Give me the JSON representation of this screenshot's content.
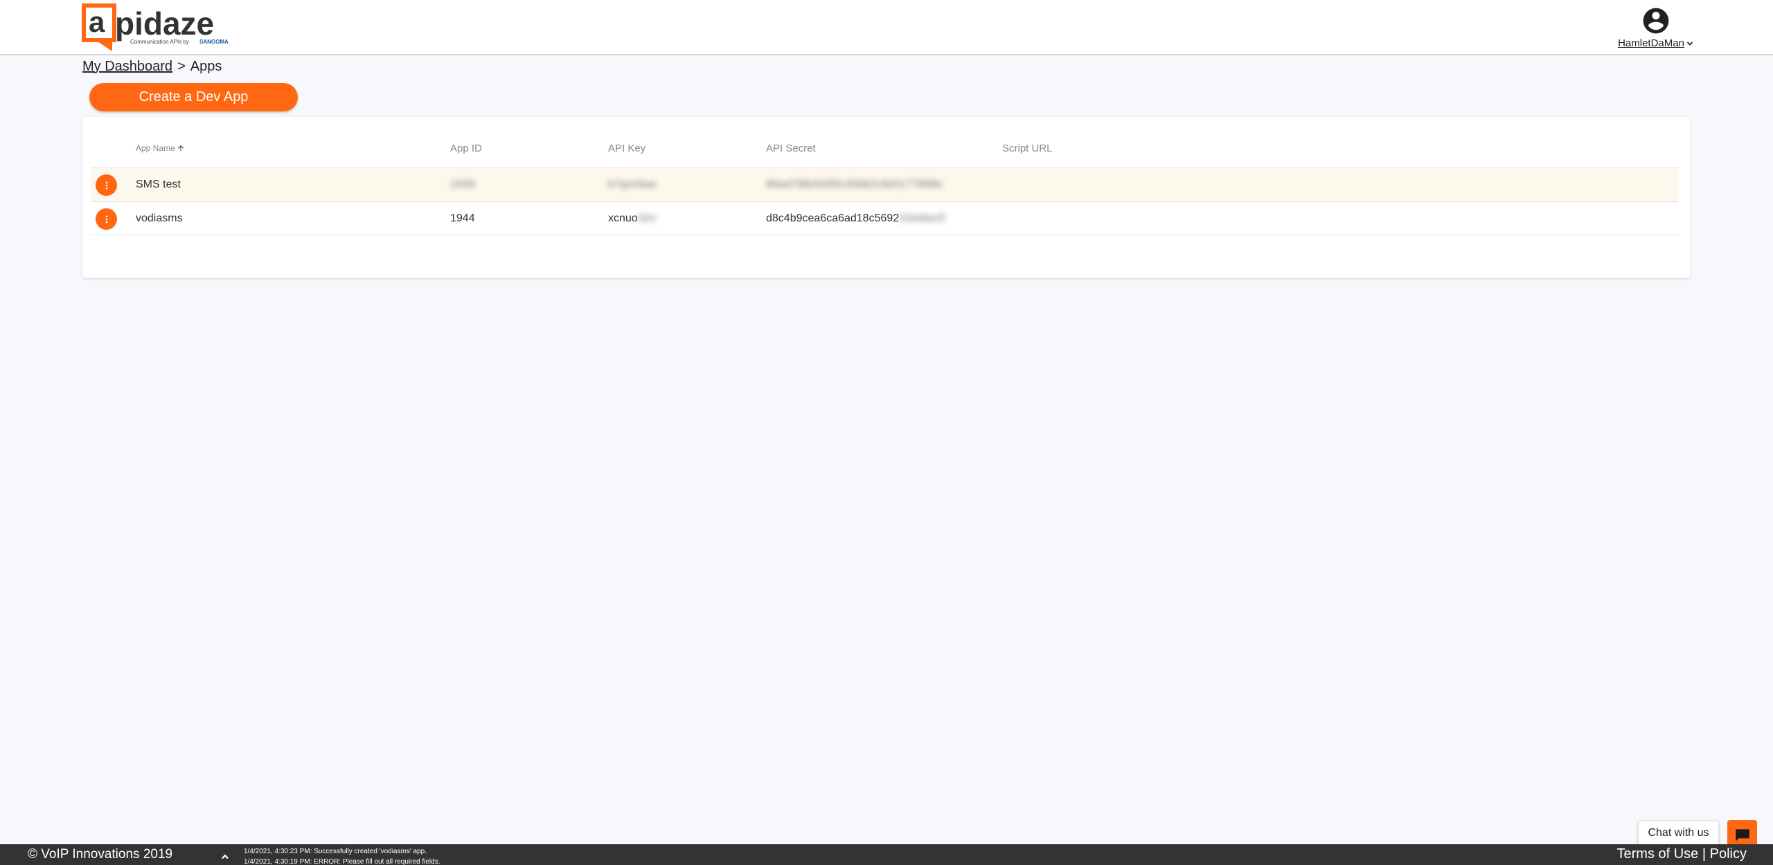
{
  "header": {
    "logo": {
      "brand": "apidaze",
      "tagline_prefix": "Communication APIs by",
      "tagline_brand": "SANGOMA"
    },
    "user": {
      "name": "HamletDaMan"
    }
  },
  "breadcrumb": {
    "parent": "My Dashboard",
    "separator": ">",
    "current": "Apps"
  },
  "actions": {
    "create_label": "Create a Dev App"
  },
  "table": {
    "columns": {
      "app_name": "App Name",
      "app_id": "App ID",
      "api_key": "API Key",
      "api_secret": "API Secret",
      "script_url": "Script URL"
    },
    "rows": [
      {
        "name": "SMS test",
        "app_id": "1939",
        "api_key": "k7qnr0aw",
        "api_secret": "86ad798e5095c45bb2c8d1177898e",
        "script_url": ""
      },
      {
        "name": "vodiasms",
        "app_id": "1944",
        "api_key_visible": "xcnuo",
        "api_key_hidden": "t3m",
        "api_secret_visible": "d8c4b9cea6ca6ad18c5692",
        "api_secret_hidden": "53ebbe2f",
        "script_url": ""
      }
    ]
  },
  "chat": {
    "label": "Chat with us"
  },
  "footer": {
    "copyright": "© VoIP Innovations 2019",
    "logs": [
      "1/4/2021, 4:30:23 PM: Successfully created 'vodiasms' app.",
      "1/4/2021, 4:30:19 PM: ERROR: Please fill out all required fields."
    ],
    "terms": "Terms of Use",
    "divider": "|",
    "policy": "Policy"
  },
  "colors": {
    "accent": "#ff6712",
    "footer_bg": "#333333",
    "row_highlight": "#fdf8ec",
    "page_bg": "#f8f8fc",
    "logo_text": "#333333",
    "logo_tagline_brand": "#1e5ea8"
  },
  "icons": {
    "user": "account-circle-icon",
    "dropdown": "chevron-down-icon",
    "sort": "arrow-up-icon",
    "row_menu": "more-vertical-icon",
    "chat": "chat-bubble-icon",
    "expand": "chevron-up-icon"
  }
}
